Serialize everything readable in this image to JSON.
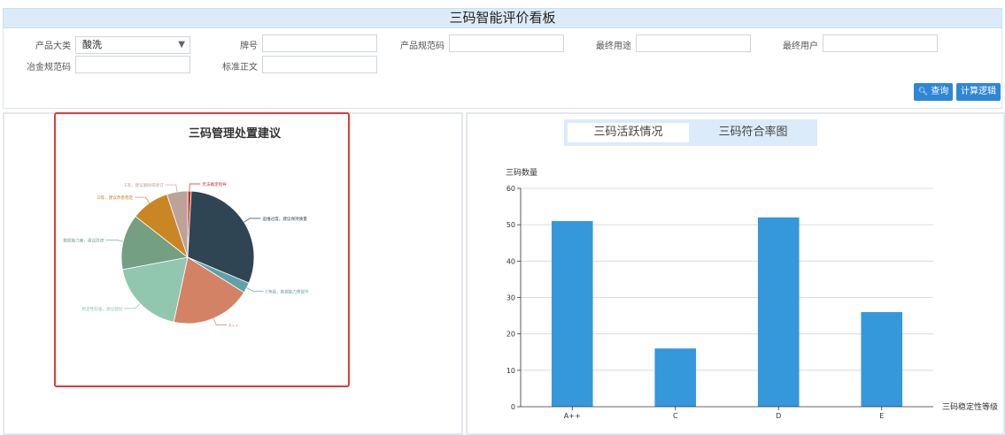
{
  "header": {
    "title": "三码智能评价看板"
  },
  "filters": {
    "product_category_label": "产品大类",
    "product_category_value": "酸洗",
    "grade_label": "牌号",
    "product_spec_label": "产品规范码",
    "end_use_label": "最终用途",
    "end_user_label": "最终用户",
    "metallurgy_spec_label": "冶金规范码",
    "standard_text_label": "标准正文",
    "dropdown_caret": "▼"
  },
  "toolbar": {
    "query_label": "查询",
    "calc_logic_label": "计算逻辑"
  },
  "pie_panel": {
    "title": "三码管理处置建议"
  },
  "tabs": [
    {
      "label": "三码活跃情况"
    },
    {
      "label": "三码符合率图"
    }
  ],
  "chart_data": [
    {
      "type": "pie",
      "title": "三码管理处置建议",
      "slices": [
        {
          "label": "无法确定指导",
          "value": 1,
          "color": "#c23531"
        },
        {
          "label": "运维过度，建议保持质量",
          "value": 36,
          "color": "#2f4554"
        },
        {
          "label": "C等级，数据能力需提升",
          "value": 3,
          "color": "#61a0a8"
        },
        {
          "label": "A++",
          "value": 23,
          "color": "#d48265"
        },
        {
          "label": "稳定性较差，建议管控",
          "value": 22,
          "color": "#91c7ae"
        },
        {
          "label": "数据能力差，建议改进",
          "value": 16,
          "color": "#749f83"
        },
        {
          "label": "D等，建议改善稳定",
          "value": 11,
          "color": "#ca8622"
        },
        {
          "label": "E等，建议删除或修订",
          "value": 6,
          "color": "#bda29a"
        }
      ]
    },
    {
      "type": "bar",
      "categories": [
        "A++",
        "C",
        "D",
        "E"
      ],
      "values": [
        51,
        16,
        52,
        26
      ],
      "xlabel": "三码稳定性等级",
      "ylabel": "三码数量",
      "ylim": [
        0,
        60
      ],
      "yticks": [
        0,
        10,
        20,
        30,
        40,
        50,
        60
      ],
      "color": "#3498db",
      "grid": true
    }
  ]
}
